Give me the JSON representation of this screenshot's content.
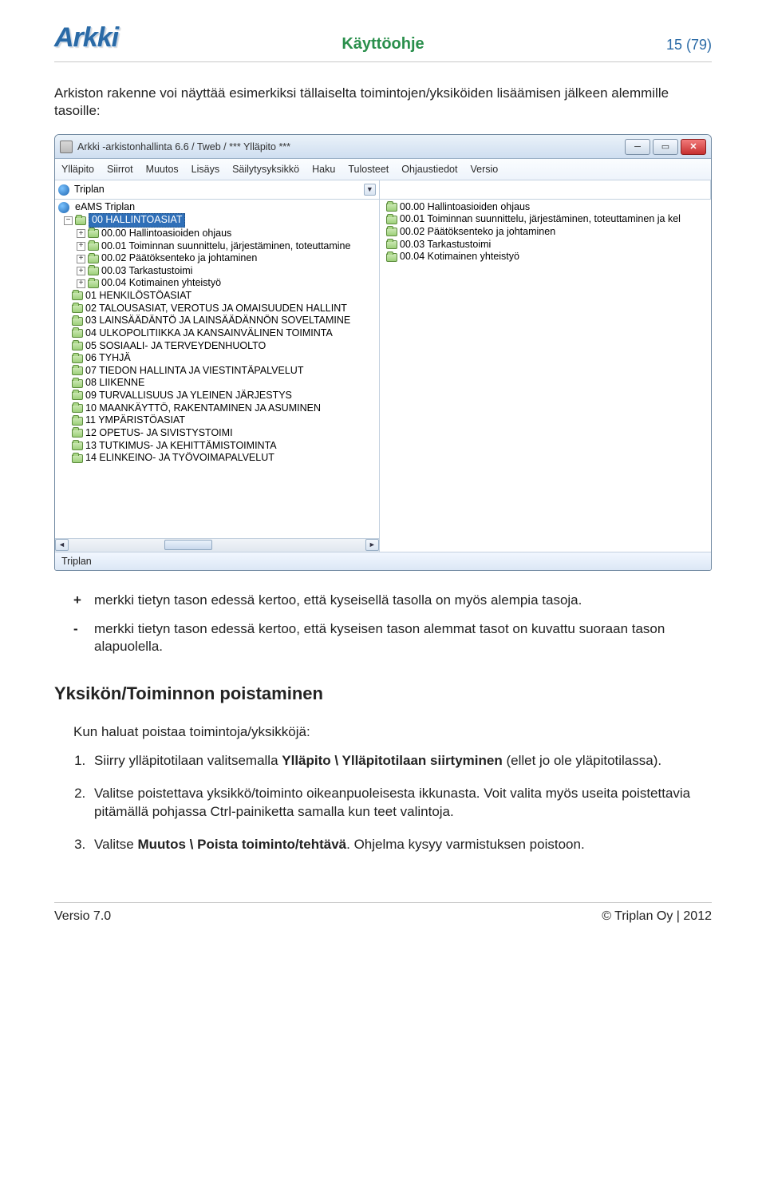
{
  "header": {
    "logo": "Arkki",
    "doc_title": "Käyttöohje",
    "page_counter": "15 (79)"
  },
  "text": {
    "pre_screenshot": "Arkiston rakenne voi näyttää esimerkiksi tällaiselta toimintojen/yksiköiden lisäämisen jälkeen alemmille tasoille:",
    "def_plus": "merkki tietyn tason edessä kertoo, että kyseisellä tasolla on myös alempia tasoja.",
    "def_minus": "merkki tietyn tason edessä kertoo, että kyseisen tason alemmat tasot on kuvattu suoraan tason alapuolella.",
    "section_title": "Yksikön/Toiminnon poistaminen",
    "section_intro": "Kun haluat poistaa toimintoja/yksikköjä:",
    "step1_a": "Siirry ylläpitotilaan valitsemalla ",
    "step1_b": "Ylläpito \\ Ylläpitotilaan siirtyminen",
    "step1_c": " (ellet jo ole yläpitotilassa).",
    "step2_a": "Valitse poistettava yksikkö/toiminto oikeanpuoleisesta ikkunasta. Voit valita myös useita poistettavia pitämällä pohjassa Ctrl-painiketta samalla kun teet valintoja.",
    "step3_a": "Valitse ",
    "step3_b": "Muutos \\ Poista toiminto/tehtävä",
    "step3_c": ". Ohjelma kysyy varmistuksen poistoon."
  },
  "footer": {
    "left": "Versio 7.0",
    "right": "© Triplan Oy | 2012"
  },
  "win": {
    "title": "Arkki -arkistonhallinta 6.6 / Tweb / *** Ylläpito ***",
    "menu": [
      "Ylläpito",
      "Siirrot",
      "Muutos",
      "Lisäys",
      "Säilytysyksikkö",
      "Haku",
      "Tulosteet",
      "Ohjaustiedot",
      "Versio"
    ],
    "combo_value": "Triplan",
    "status": "Triplan",
    "tree_root": "eAMS Triplan",
    "tree_selected": "00 HALLINTOASIAT",
    "tree_sub": [
      "00.00 Hallintoasioiden ohjaus",
      "00.01 Toiminnan suunnittelu, järjestäminen, toteuttamine",
      "00.02 Päätöksenteko ja johtaminen",
      "00.03 Tarkastustoimi",
      "00.04 Kotimainen yhteistyö"
    ],
    "tree_rest": [
      "01 HENKILÖSTÖASIAT",
      "02 TALOUSASIAT, VEROTUS JA OMAISUUDEN HALLINT",
      "03 LAINSÄÄDÄNTÖ JA LAINSÄÄDÄNNÖN SOVELTAMINE",
      "04 ULKOPOLITIIKKA JA KANSAINVÄLINEN TOIMINTA",
      "05 SOSIAALI- JA TERVEYDENHUOLTO",
      "06 TYHJÄ",
      "07 TIEDON HALLINTA JA VIESTINTÄPALVELUT",
      "08 LIIKENNE",
      "09 TURVALLISUUS JA YLEINEN JÄRJESTYS",
      "10 MAANKÄYTTÖ, RAKENTAMINEN JA ASUMINEN",
      "11 YMPÄRISTÖASIAT",
      "12 OPETUS- JA SIVISTYSTOIMI",
      "13 TUTKIMUS- JA KEHITTÄMISTOIMINTA",
      "14 ELINKEINO- JA TYÖVOIMAPALVELUT"
    ],
    "right_list": [
      "00.00 Hallintoasioiden ohjaus",
      "00.01 Toiminnan suunnittelu, järjestäminen, toteuttaminen ja kel",
      "00.02 Päätöksenteko ja johtaminen",
      "00.03 Tarkastustoimi",
      "00.04 Kotimainen yhteistyö"
    ]
  }
}
